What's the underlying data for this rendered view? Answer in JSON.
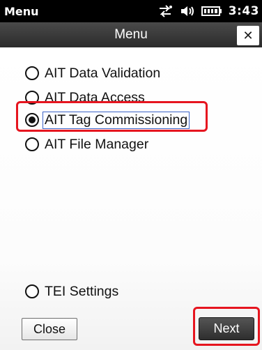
{
  "status_bar": {
    "app_name": "Menu",
    "time": "3:43",
    "icons": [
      "connectivity-icon",
      "speaker-icon",
      "battery-icon"
    ]
  },
  "title_bar": {
    "title": "Menu",
    "close_symbol": "✕"
  },
  "options": [
    {
      "label": "AIT Data Validation",
      "checked": false
    },
    {
      "label": "AIT Data Access",
      "checked": false
    },
    {
      "label": "AIT Tag Commissioning",
      "checked": true
    },
    {
      "label": "AIT File Manager",
      "checked": false
    }
  ],
  "settings_option": {
    "label": "TEI Settings",
    "checked": false
  },
  "buttons": {
    "close_label": "Close",
    "next_label": "Next"
  },
  "colors": {
    "highlight": "#e6151f",
    "focus_border": "#3c63c7"
  }
}
